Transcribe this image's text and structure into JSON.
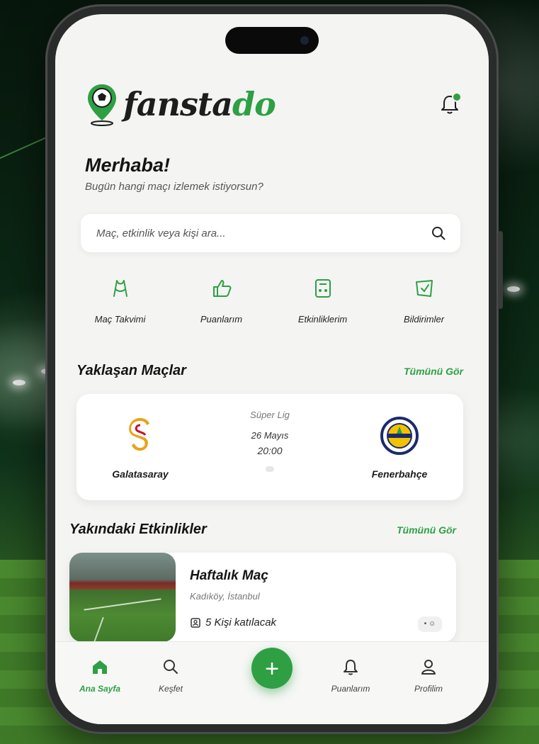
{
  "app": {
    "name_part1": "fansta",
    "name_part2": "do",
    "accent_color": "#2ea043"
  },
  "greeting": {
    "title": "Merhaba!",
    "subtitle": "Bugün hangi maçı izlemek istiyorsun?"
  },
  "search": {
    "placeholder": "Maç, etkinlik veya kişi ara...",
    "icon": "search-icon"
  },
  "quick_actions": [
    {
      "label": "Maç Takvimi",
      "icon": "stadium-icon"
    },
    {
      "label": "Puanlarım",
      "icon": "thumbs-up-icon"
    },
    {
      "label": "Etkinliklerim",
      "icon": "ticket-icon"
    },
    {
      "label": "Bildirimler",
      "icon": "notification-icon"
    }
  ],
  "upcoming_matches": {
    "title": "Yaklaşan Maçlar",
    "see_all": "Tümünü Gör",
    "match": {
      "league": "Süper Lig",
      "date": "26 Mayıs",
      "time": "20:00",
      "home": "Galatasaray",
      "away": "Fenerbahçe"
    }
  },
  "nearby_events": {
    "title": "Yakındaki Etkinlikler",
    "see_all": "Tümünü Gör",
    "event": {
      "title": "Haftalık Maç",
      "location": "Kadıköy, İstanbul",
      "attendees": "5 Kişi katılacak"
    }
  },
  "tabs": [
    {
      "label": "Ana Sayfa",
      "icon": "home-icon",
      "active": true
    },
    {
      "label": "Keşfet",
      "icon": "search-icon",
      "active": false
    },
    {
      "label": "Puanlarım",
      "icon": "bell-icon",
      "active": false
    },
    {
      "label": "Profilim",
      "icon": "user-icon",
      "active": false
    }
  ]
}
